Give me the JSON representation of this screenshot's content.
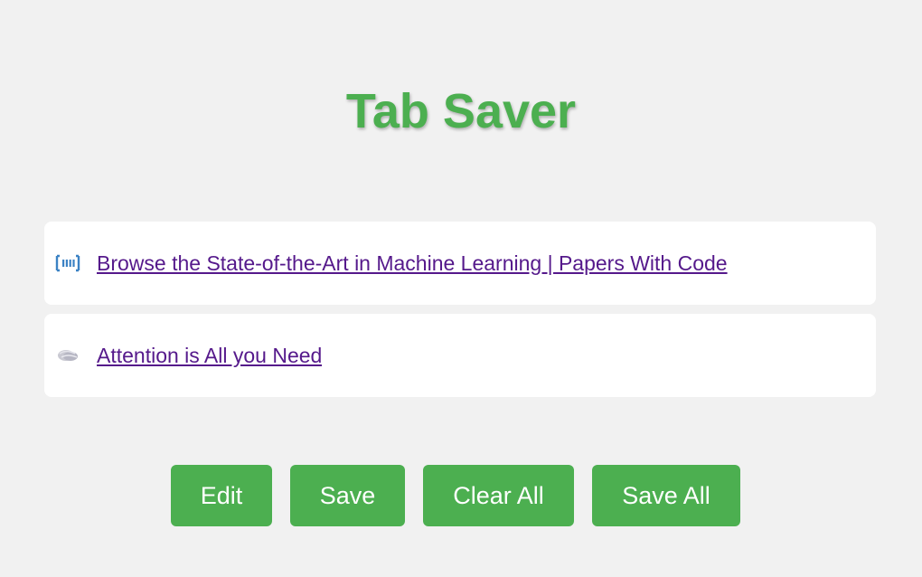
{
  "app": {
    "title": "Tab Saver"
  },
  "tabs": [
    {
      "title": "Browse the State-of-the-Art in Machine Learning | Papers With Code",
      "favicon": "papers-with-code-icon"
    },
    {
      "title": "Attention is All you Need",
      "favicon": "semantic-scholar-icon"
    }
  ],
  "buttons": {
    "edit": "Edit",
    "save": "Save",
    "clear_all": "Clear All",
    "save_all": "Save All"
  },
  "colors": {
    "accent": "#4caf50",
    "background": "#f1f1f1",
    "link": "#55198b",
    "card": "#ffffff"
  }
}
